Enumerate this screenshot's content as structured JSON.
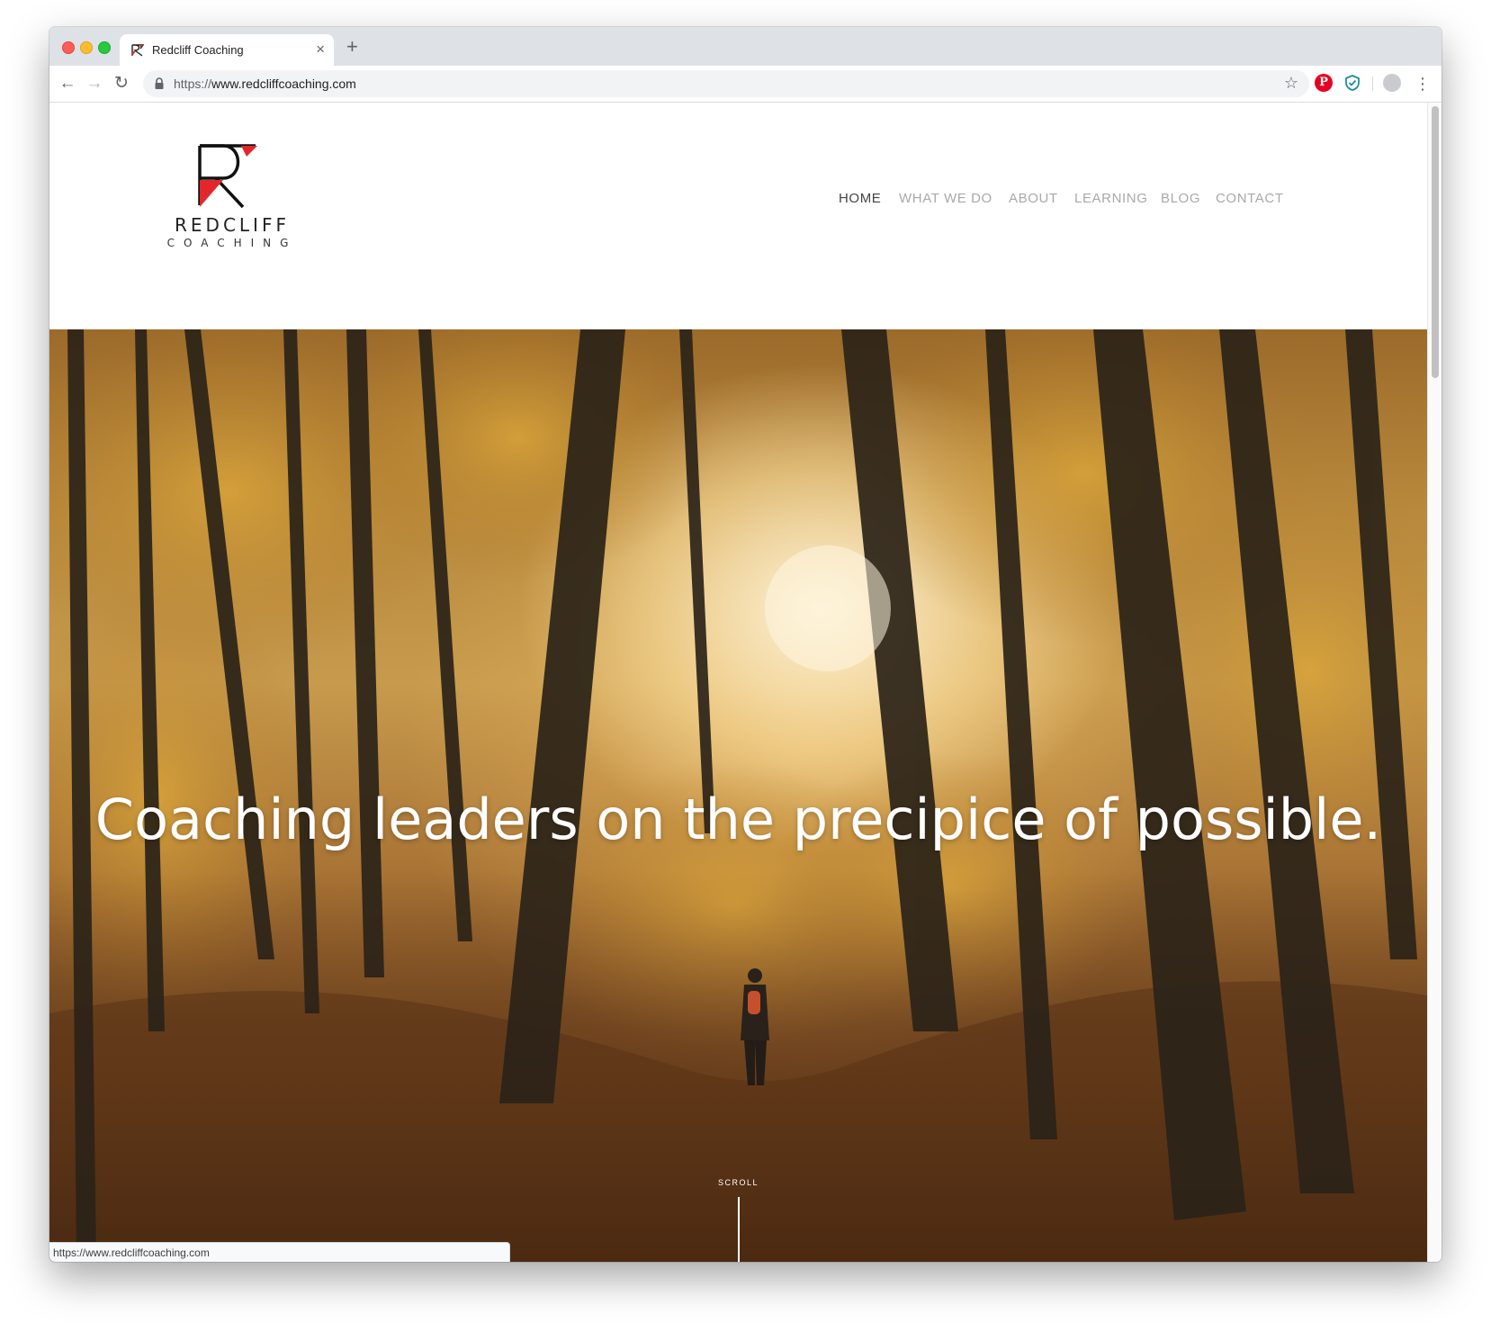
{
  "browser": {
    "tab_title": "Redcliff Coaching",
    "tab_close": "×",
    "new_tab": "+",
    "url_scheme": "https://",
    "url_host": "www.redcliffcoaching.com",
    "status_url": "https://www.redcliffcoaching.com",
    "icons": {
      "back": "back-arrow-icon",
      "forward": "forward-arrow-icon",
      "reload": "reload-icon",
      "lock": "lock-icon",
      "star": "star-icon",
      "menu": "kebab-menu-icon"
    },
    "extensions": [
      "pinterest-icon",
      "shield-extension-icon",
      "profile-avatar-icon"
    ],
    "colors": {
      "tabstrip": "#dee1e6",
      "pinterest": "#e60023",
      "shield": "#1e8ea3"
    }
  },
  "site": {
    "logo": {
      "word": "REDCLIFF",
      "sub": "COACHING",
      "accent_color": "#e3262d"
    },
    "nav": [
      {
        "label": "HOME",
        "active": true
      },
      {
        "label": "WHAT WE DO",
        "active": false
      },
      {
        "label": "ABOUT",
        "active": false
      },
      {
        "label": "LEARNING",
        "active": false
      },
      {
        "label": "BLOG",
        "active": false
      },
      {
        "label": "CONTACT",
        "active": false
      }
    ],
    "hero": {
      "headline": "Coaching leaders on the precipice of possible.",
      "scroll_label": "SCROLL"
    }
  }
}
